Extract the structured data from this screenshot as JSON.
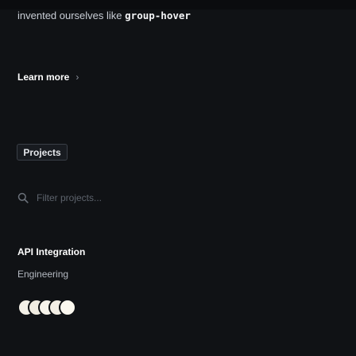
{
  "headline": {
    "text": "invented ourselves like ",
    "code": "group-hover"
  },
  "learn_more": {
    "label": "Learn more",
    "chevron": "›"
  },
  "tab": {
    "label": "Projects"
  },
  "search": {
    "placeholder": "Filter projects...",
    "value": "",
    "icon": "search-icon"
  },
  "project": {
    "title": "API Integration",
    "category": "Engineering",
    "avatars": 5
  },
  "colors": {
    "background": "#101215",
    "text": "#ffffff",
    "muted": "#b4b9c1",
    "avatar": "#f4f1e8"
  }
}
